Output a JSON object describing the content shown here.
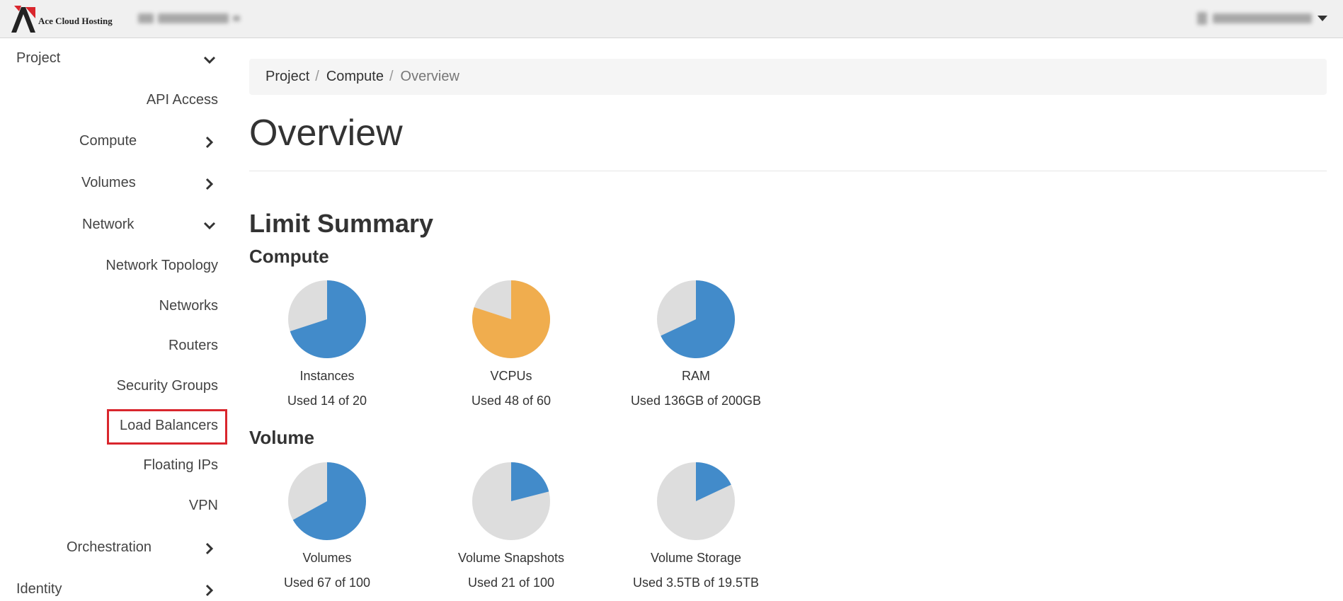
{
  "brand": {
    "name": "Ace Cloud Hosting"
  },
  "colors": {
    "accent_blue": "#428bca",
    "warning_orange": "#f0ad4e",
    "empty_gray": "#dddddd",
    "highlight_red": "#d9262d"
  },
  "sidebar": {
    "project": "Project",
    "api_access": "API Access",
    "compute": "Compute",
    "volumes": "Volumes",
    "network": "Network",
    "network_items": [
      "Network Topology",
      "Networks",
      "Routers",
      "Security Groups",
      "Load Balancers",
      "Floating IPs",
      "VPN"
    ],
    "orchestration": "Orchestration",
    "identity": "Identity"
  },
  "breadcrumb": [
    "Project",
    "Compute",
    "Overview"
  ],
  "page_title": "Overview",
  "limit_summary": {
    "title": "Limit Summary",
    "compute_title": "Compute",
    "volume_title": "Volume",
    "compute": [
      {
        "label": "Instances",
        "used_text": "Used 14 of 20",
        "fraction": 0.7,
        "color": "#428bca"
      },
      {
        "label": "VCPUs",
        "used_text": "Used 48 of 60",
        "fraction": 0.8,
        "color": "#f0ad4e"
      },
      {
        "label": "RAM",
        "used_text": "Used 136GB of 200GB",
        "fraction": 0.68,
        "color": "#428bca"
      }
    ],
    "volume": [
      {
        "label": "Volumes",
        "used_text": "Used 67 of 100",
        "fraction": 0.67,
        "color": "#428bca"
      },
      {
        "label": "Volume Snapshots",
        "used_text": "Used 21 of 100",
        "fraction": 0.21,
        "color": "#428bca"
      },
      {
        "label": "Volume Storage",
        "used_text": "Used 3.5TB of 19.5TB",
        "fraction": 0.18,
        "color": "#428bca"
      }
    ]
  }
}
